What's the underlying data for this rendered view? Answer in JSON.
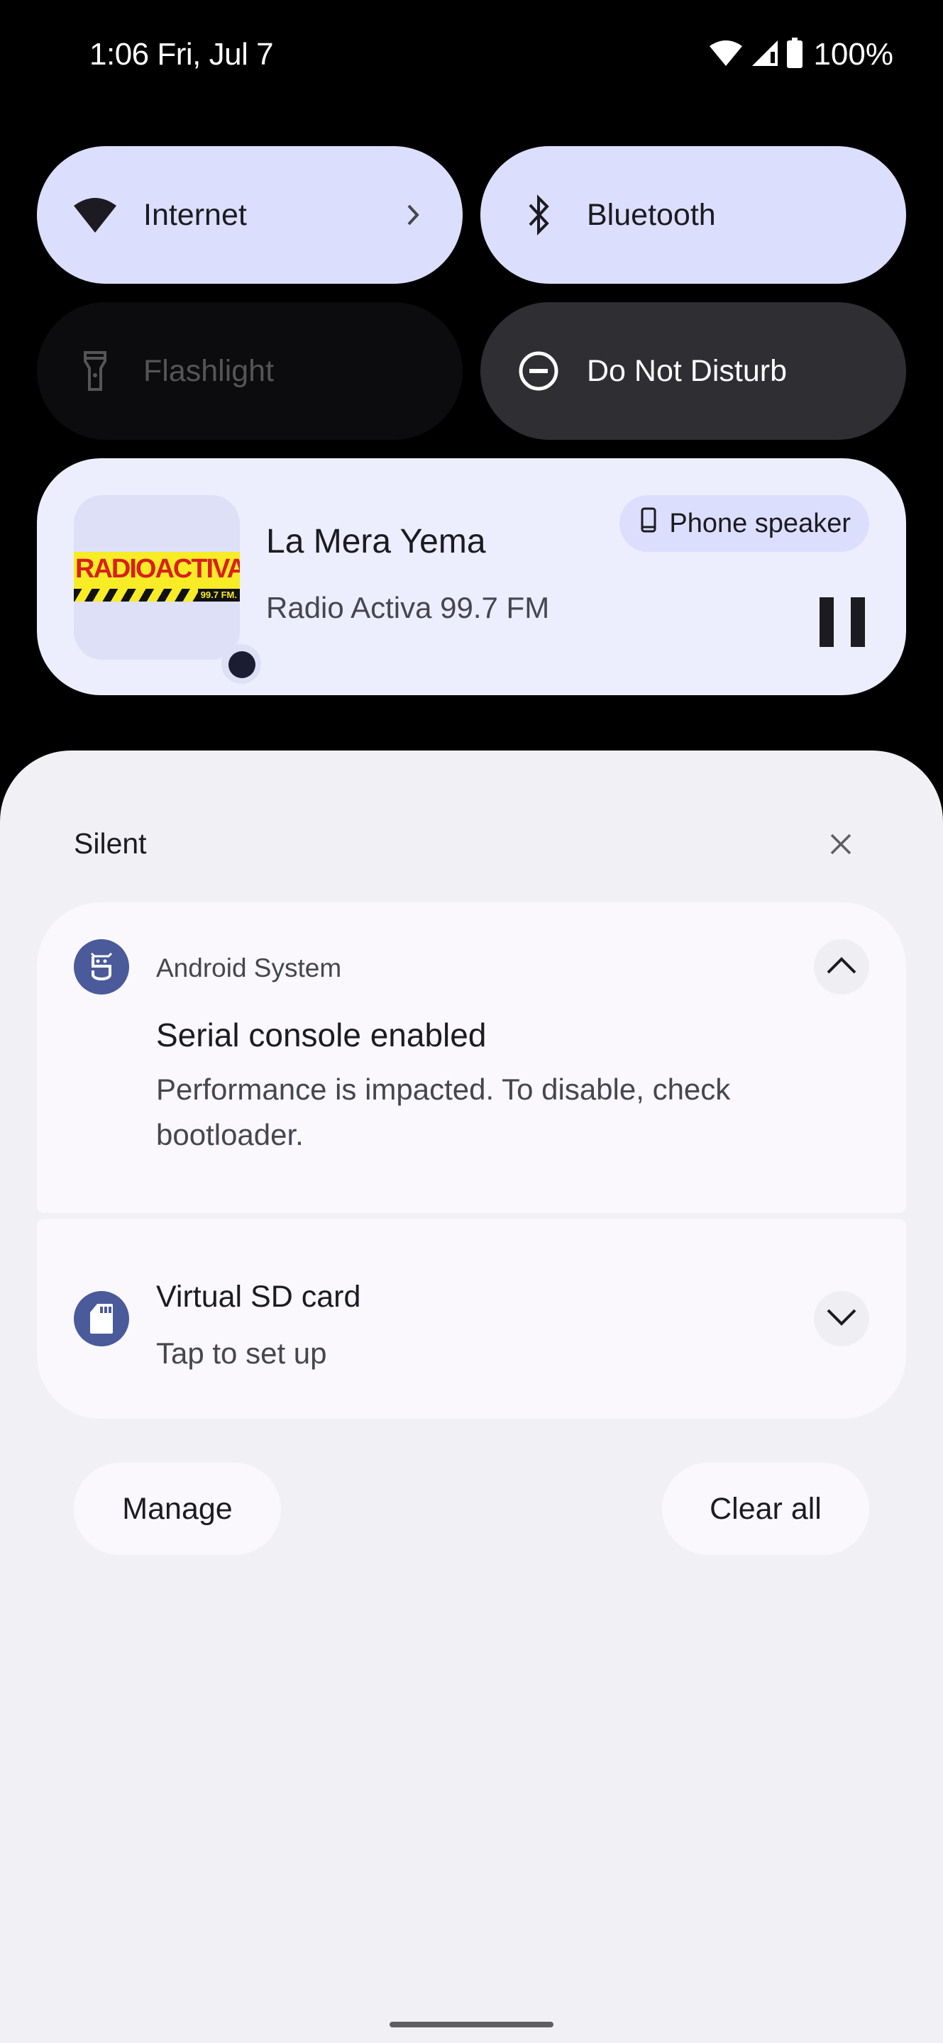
{
  "status_bar": {
    "time": "1:06 Fri, Jul 7",
    "battery_percent": "100%",
    "icons": [
      "wifi-icon",
      "cell-signal-icon",
      "battery-icon"
    ]
  },
  "quick_settings": {
    "tiles": [
      {
        "label": "Internet",
        "icon": "wifi-icon",
        "state": "on",
        "has_chevron": true
      },
      {
        "label": "Bluetooth",
        "icon": "bluetooth-icon",
        "state": "on"
      },
      {
        "label": "Flashlight",
        "icon": "flashlight-icon",
        "state": "unavailable"
      },
      {
        "label": "Do Not Disturb",
        "icon": "do-not-disturb-icon",
        "state": "off"
      }
    ]
  },
  "media_player": {
    "title": "La Mera Yema",
    "subtitle": "Radio Activa 99.7 FM",
    "album_art": {
      "logo_text": "RADIOACTIVA",
      "logo_frequency": "99.7 FM."
    },
    "output_chip": "Phone speaker",
    "play_state": "playing"
  },
  "notifications": {
    "section_title": "Silent",
    "items": [
      {
        "app_name": "Android System",
        "title": "Serial console enabled",
        "body": "Performance is impacted. To disable, check bootloader.",
        "expanded": true
      },
      {
        "title": "Virtual SD card",
        "body": "Tap to set up",
        "expanded": false
      }
    ],
    "manage_label": "Manage",
    "clear_all_label": "Clear all"
  },
  "colors": {
    "tile_on": "#dcdefd",
    "tile_dnd": "#2e2e33",
    "media_bg": "#eceefd",
    "shade_bg": "#f1f0f4",
    "card_bg": "#faf8fd",
    "app_icon": "#4a5a9a"
  }
}
